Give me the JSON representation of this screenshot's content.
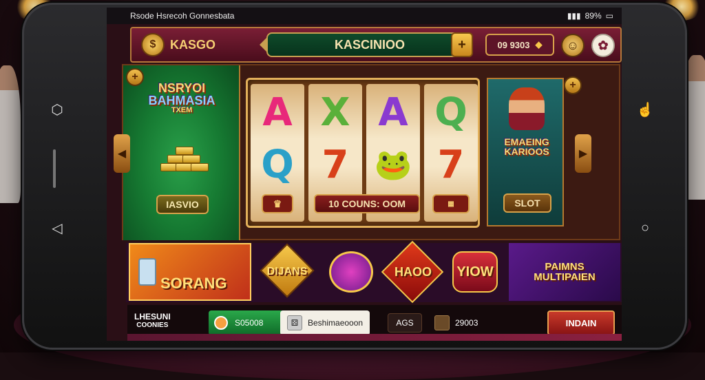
{
  "status": {
    "title": "Rsode Hsrecoh Gonnesbata",
    "battery": "89%"
  },
  "header": {
    "logo_text": "KASGO",
    "logo_glyph": "$",
    "search_text": "KASCINIOO",
    "search_plus": "+",
    "balance_text": "09 9303",
    "profile_icon": "☺",
    "settings_icon": "✿"
  },
  "featured_left": {
    "badge": "+",
    "title_line1": "NSRYOI",
    "title_line2": "BAHMASIA",
    "title_line3": "TXEM",
    "button": "IAS​VIO"
  },
  "reels": {
    "symbols": [
      [
        "A",
        "Q",
        "👑"
      ],
      [
        "X",
        "7",
        ""
      ],
      [
        "A",
        "🐸",
        ""
      ],
      [
        "Q",
        "7",
        "🎰"
      ]
    ],
    "colors": [
      "#e8287a",
      "#5ab03a",
      "#8a3ad0",
      "#4caf50"
    ],
    "win_label": "10 COUNS: OOM"
  },
  "featured_right": {
    "badge": "+",
    "title_line1": "EMAEING",
    "title_line2": "KARIOOS",
    "button": "SLOT"
  },
  "tiles": [
    {
      "label": "SORANG"
    },
    {
      "label": "DIJANS"
    },
    {
      "label": ""
    },
    {
      "label": "HAOO"
    },
    {
      "label": "YIOW"
    },
    {
      "label": "PAIMNS MULTIPAIEN"
    }
  ],
  "footer": {
    "left_line1": "LHESUNI",
    "left_line2": "COONIES",
    "green_label": "S05008",
    "white_label": "Beshimaeooon",
    "age_label": "AGS",
    "amount_label": "29003",
    "cta": "INDAIN"
  },
  "colors": {
    "accent_gold": "#d8a24a",
    "header_red": "#7a1e35",
    "green": "#1e8a3a",
    "cta_red": "#b22a2a"
  }
}
